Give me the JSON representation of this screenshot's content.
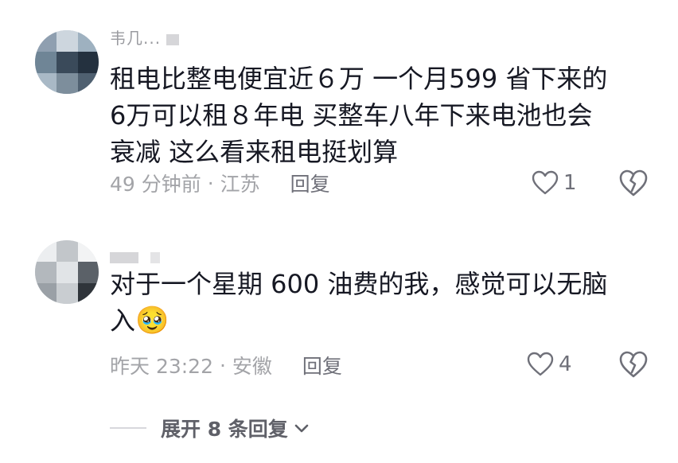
{
  "comments": [
    {
      "username": "韦几...",
      "text": "租电比整电便宜近６万 一个月599 省下来的\n6万可以租８年电 买整车八年下来电池也会\n衰减 这么看来租电挺划算",
      "time": "49 分钟前",
      "location": "江苏",
      "reply_label": "回复",
      "likes": "1"
    },
    {
      "username": "",
      "text": "对于一个星期 600 油费的我，感觉可以无脑\n入",
      "emoji": "🥹",
      "emoji_name": "pleading-face",
      "time": "昨天 23:22",
      "location": "安徽",
      "reply_label": "回复",
      "likes": "4"
    }
  ],
  "expand_replies_label": "展开 8 条回复",
  "icons": {
    "like": "heart-outline-icon",
    "dislike": "broken-heart-icon",
    "expand": "chevron-down-icon"
  },
  "colors": {
    "text_primary": "#161823",
    "text_secondary": "#a3a4a8",
    "action_gray": "#6f7079"
  }
}
